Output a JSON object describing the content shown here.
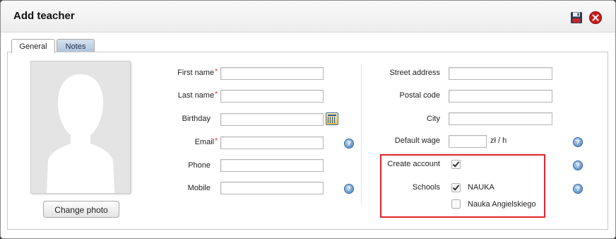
{
  "dialog": {
    "title": "Add teacher",
    "save_icon": "save-icon",
    "close_icon": "close-icon"
  },
  "tabs": [
    {
      "label": "General",
      "active": true
    },
    {
      "label": "Notes",
      "active": false
    }
  ],
  "photo": {
    "change_label": "Change photo"
  },
  "left_fields": {
    "first_name": {
      "label": "First name",
      "required": "*",
      "value": ""
    },
    "last_name": {
      "label": "Last name",
      "required": "*",
      "value": ""
    },
    "birthday": {
      "label": "Birthday",
      "value": ""
    },
    "email": {
      "label": "Email",
      "required": "*",
      "value": ""
    },
    "phone": {
      "label": "Phone",
      "value": ""
    },
    "mobile": {
      "label": "Mobile",
      "value": ""
    }
  },
  "right_fields": {
    "street": {
      "label": "Street address",
      "value": ""
    },
    "postal": {
      "label": "Postal code",
      "value": ""
    },
    "city": {
      "label": "City",
      "value": ""
    },
    "wage": {
      "label": "Default wage",
      "value": "",
      "unit": "zł / h"
    },
    "create_account": {
      "label": "Create account",
      "checked": true
    },
    "schools": {
      "label": "Schools",
      "options": [
        {
          "name": "NAUKA",
          "checked": true
        },
        {
          "name": "Nauka Angielskiego",
          "checked": false
        }
      ]
    }
  },
  "colors": {
    "highlight": "#e3232b",
    "required": "#dd2233",
    "close": "#c8201f"
  }
}
